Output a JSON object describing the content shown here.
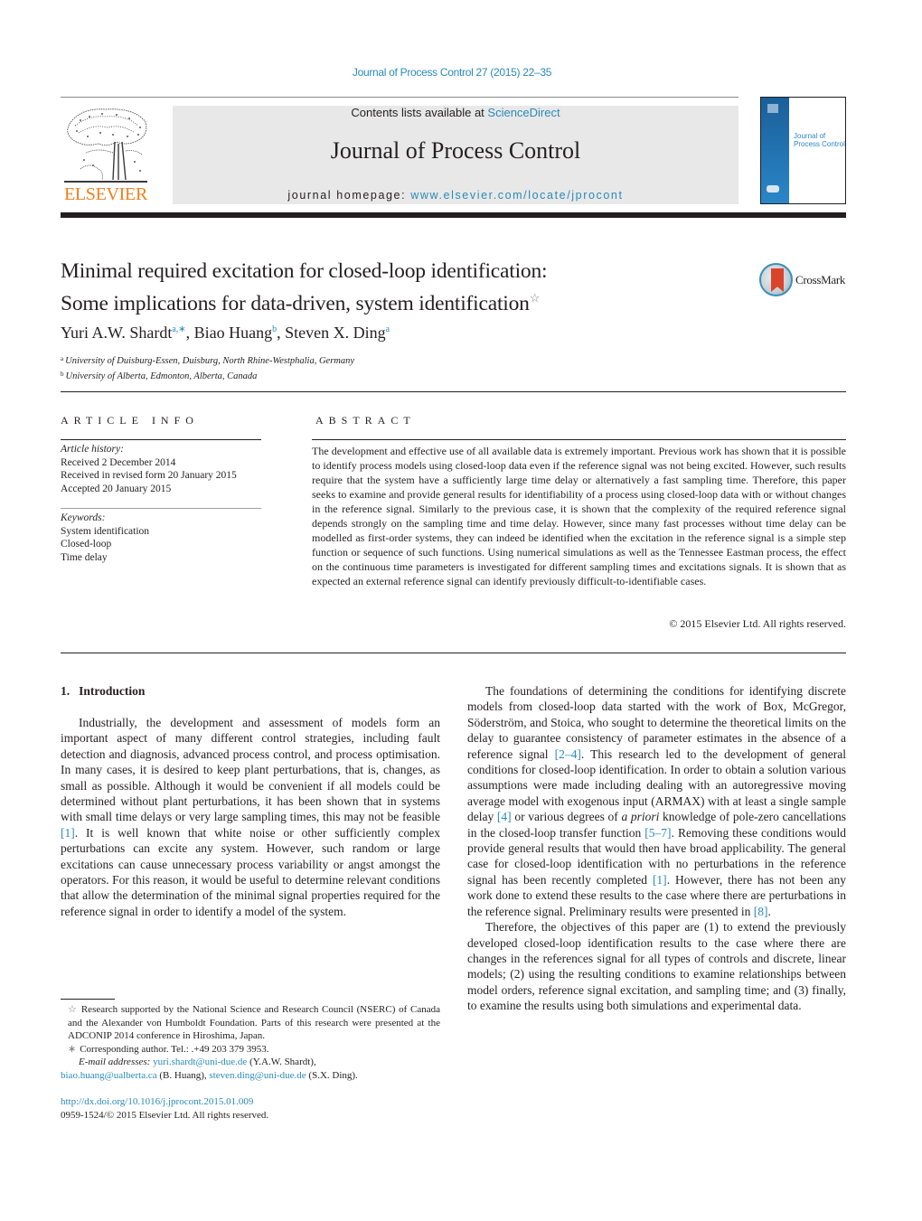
{
  "running_head": "Journal of Process Control 27 (2015) 22–35",
  "masthead": {
    "publisher": "ELSEVIER",
    "contents_prefix": "Contents lists available at ",
    "contents_link": "ScienceDirect",
    "journal_title": "Journal of Process Control",
    "homepage_prefix": "journal homepage: ",
    "homepage_link": "www.elsevier.com/locate/jprocont",
    "cover_title_line1": "Journal of",
    "cover_title_line2": "Process Control"
  },
  "crossmark_label": "CrossMark",
  "article": {
    "title_line1": "Minimal required excitation for closed-loop identification:",
    "title_line2": "Some implications for data-driven, system identification",
    "title_note_symbol": "☆",
    "authors": [
      {
        "name": "Yuri A.W. Shardt",
        "sup": "a,∗",
        "sep": ", "
      },
      {
        "name": "Biao Huang",
        "sup": "b",
        "sep": ", "
      },
      {
        "name": "Steven X. Ding",
        "sup": "a",
        "sep": ""
      }
    ],
    "affiliations": [
      {
        "key": "a",
        "text": "University of Duisburg-Essen, Duisburg, North Rhine-Westphalia, Germany"
      },
      {
        "key": "b",
        "text": "University of Alberta, Edmonton, Alberta, Canada"
      }
    ]
  },
  "article_info": {
    "heading": "ARTICLE INFO",
    "history_label": "Article history:",
    "history": [
      "Received 2 December 2014",
      "Received in revised form 20 January 2015",
      "Accepted 20 January 2015"
    ],
    "keywords_label": "Keywords:",
    "keywords": [
      "System identification",
      "Closed-loop",
      "Time delay"
    ]
  },
  "abstract": {
    "heading": "ABSTRACT",
    "text": "The development and effective use of all available data is extremely important. Previous work has shown that it is possible to identify process models using closed-loop data even if the reference signal was not being excited. However, such results require that the system have a sufficiently large time delay or alternatively a fast sampling time. Therefore, this paper seeks to examine and provide general results for identifiability of a process using closed-loop data with or without changes in the reference signal. Similarly to the previous case, it is shown that the complexity of the required reference signal depends strongly on the sampling time and time delay. However, since many fast processes without time delay can be modelled as first-order systems, they can indeed be identified when the excitation in the reference signal is a simple step function or sequence of such functions. Using numerical simulations as well as the Tennessee Eastman process, the effect on the continuous time parameters is investigated for different sampling times and excitations signals. It is shown that as expected an external reference signal can identify previously difficult-to-identifiable cases.",
    "copyright": "© 2015 Elsevier Ltd. All rights reserved."
  },
  "intro": {
    "number": "1.",
    "heading": "Introduction",
    "p1_a": "Industrially, the development and assessment of models form an important aspect of many different control strategies, including fault detection and diagnosis, advanced process control, and process optimisation. In many cases, it is desired to keep plant perturbations, that is, changes, as small as possible. Although it would be convenient if all models could be determined without plant perturbations, it has been shown that in systems with small time delays or very large sampling times, this may not be feasible ",
    "p1_ref1": "[1]",
    "p1_b": ". It is well known that white noise or other sufficiently complex perturbations can excite any system. However, such random or large excitations can cause unnecessary process variability or angst amongst the operators. For this reason, it would be useful to determine relevant conditions that allow the determination of the minimal signal properties required for the reference signal in order to identify a model of the system.",
    "p2_a": "The foundations of determining the conditions for identifying discrete models from closed-loop data started with the work of Box, McGregor, Söderström, and Stoica, who sought to determine the theoretical limits on the delay to guarantee consistency of parameter estimates in the absence of a reference signal ",
    "p2_ref1": "[2–4]",
    "p2_b": ". This research led to the development of general conditions for closed-loop identification. In order to obtain a solution various assumptions were made including dealing with an autoregressive moving average model with exogenous input (ARMAX) with at least a single sample delay ",
    "p2_ref2": "[4]",
    "p2_c": " or various degrees of ",
    "p2_italic": "a priori",
    "p2_d": " knowledge of pole-zero cancellations in the closed-loop transfer function ",
    "p2_ref3": "[5–7]",
    "p2_e": ". Removing these conditions would provide general results that would then have broad applicability. The general case for closed-loop identification with no perturbations in the reference signal has been recently completed ",
    "p2_ref4": "[1]",
    "p2_f": ". However, there has not been any work done to extend these results to the case where there are perturbations in the reference signal. Preliminary results were presented in ",
    "p2_ref5": "[8]",
    "p2_g": ".",
    "p3": "Therefore, the objectives of this paper are (1) to extend the previously developed closed-loop identification results to the case where there are changes in the references signal for all types of controls and discrete, linear models; (2) using the resulting conditions to examine relationships between model orders, reference signal excitation, and sampling time; and (3) finally, to examine the results using both simulations and experimental data."
  },
  "footnotes": {
    "star_symbol": "☆",
    "funding": "Research supported by the National Science and Research Council (NSERC) of Canada and the Alexander von Humboldt Foundation. Parts of this research were presented at the ADCONIP 2014 conference in Hiroshima, Japan.",
    "corr_symbol": "∗",
    "corresponding": "Corresponding author. Tel.: .+49 203 379 3953.",
    "email_label": "E-mail addresses:",
    "emails": [
      {
        "address": "yuri.shardt@uni-due.de",
        "owner": " (Y.A.W. Shardt),"
      },
      {
        "address": "biao.huang@ualberta.ca",
        "owner": " (B. Huang), "
      },
      {
        "address": "steven.ding@uni-due.de",
        "owner": " (S.X. Ding)."
      }
    ],
    "doi": "http://dx.doi.org/10.1016/j.jprocont.2015.01.009",
    "issn_line": "0959-1524/© 2015 Elsevier Ltd. All rights reserved."
  },
  "colors": {
    "link": "#2a8ab8",
    "elsevier_orange": "#f07f1e",
    "masthead_bg": "#e8e8e8",
    "crossmark_red": "#d9452b"
  }
}
